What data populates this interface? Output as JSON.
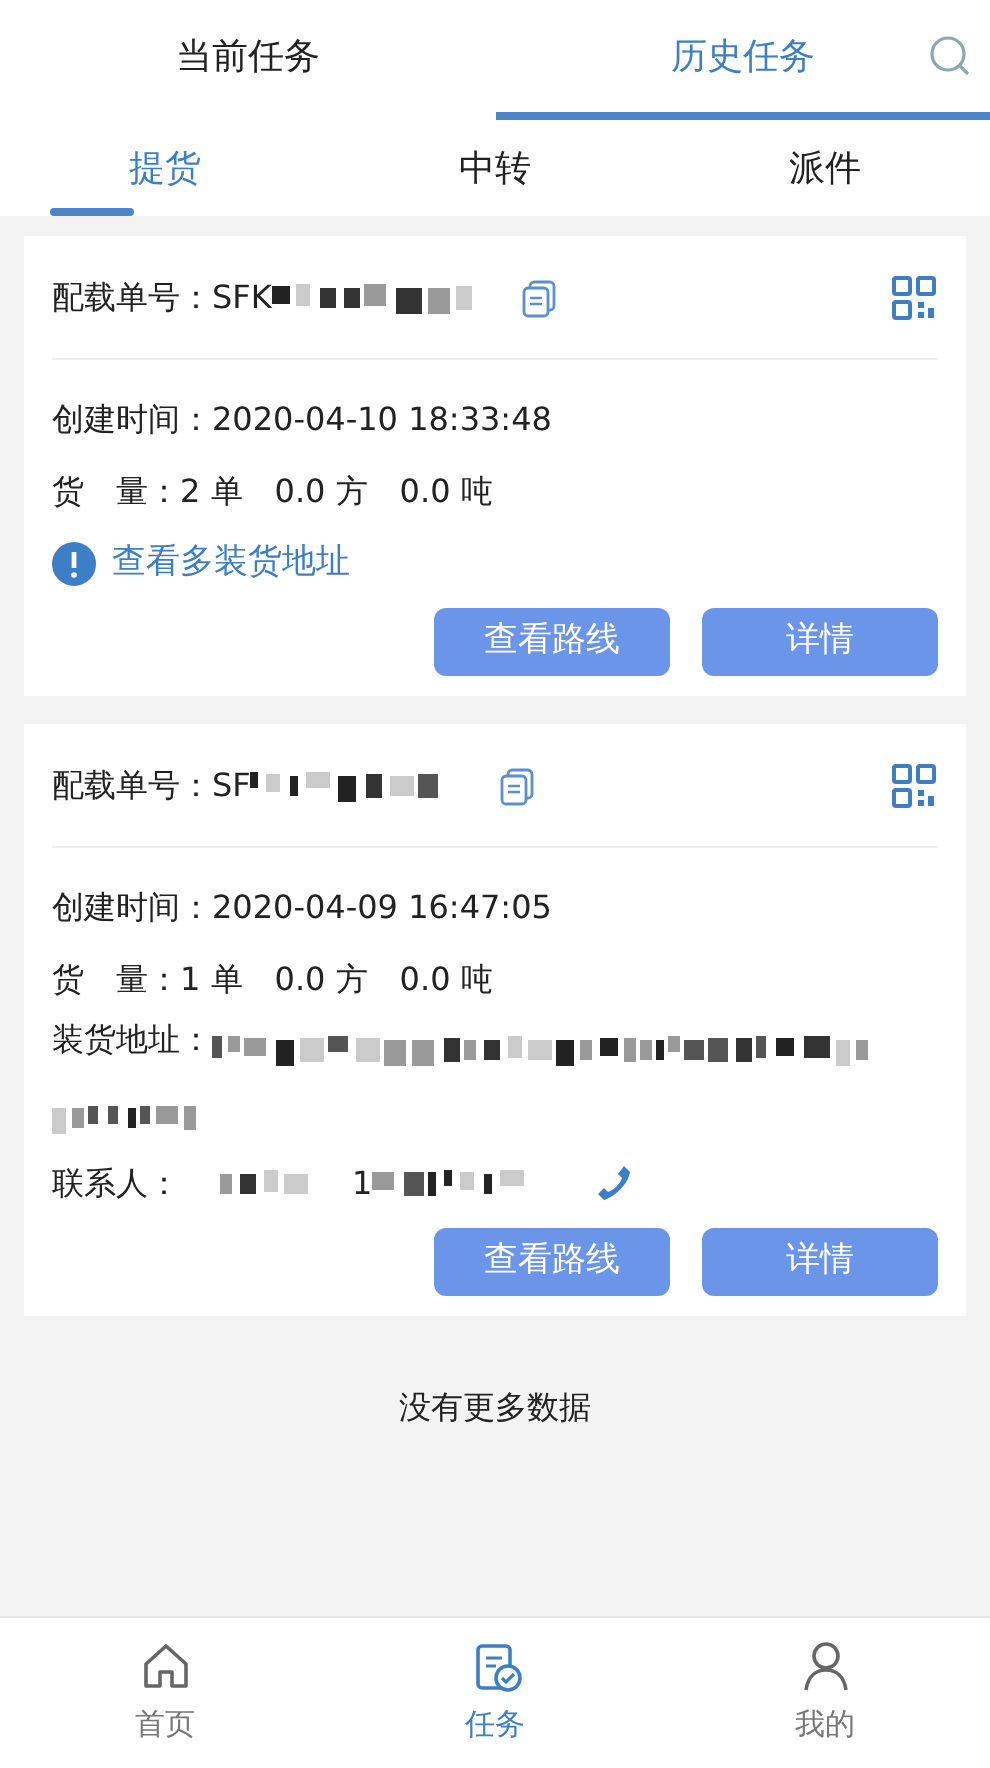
{
  "top_tabs": [
    {
      "label": "当前任务",
      "selected": false
    },
    {
      "label": "历史任务",
      "selected": true
    }
  ],
  "sub_tabs": [
    {
      "label": "提货",
      "selected": true
    },
    {
      "label": "中转",
      "selected": false
    },
    {
      "label": "派件",
      "selected": false
    }
  ],
  "cards": [
    {
      "order_label": "配载单号：",
      "order_no": "SFK",
      "rows": [
        {
          "kind": "text",
          "label": "创建时间：",
          "value": "2020-04-10 18:33:48"
        },
        {
          "kind": "text",
          "label": "货　量：",
          "value": "2 单　0.0 方　0.0 吨"
        },
        {
          "kind": "link",
          "text": "查看多装货地址"
        }
      ],
      "buttons": [
        "查看路线",
        "详情"
      ]
    },
    {
      "order_label": "配载单号：",
      "order_no": "SF",
      "rows": [
        {
          "kind": "text",
          "label": "创建时间：",
          "value": "2020-04-09 16:47:05"
        },
        {
          "kind": "text",
          "label": "货　量：",
          "value": "1 单　0.0 方　0.0 吨"
        },
        {
          "kind": "address",
          "label": "装货地址："
        },
        {
          "kind": "contact",
          "label": "联系人：",
          "phone": "1"
        }
      ],
      "buttons": [
        "查看路线",
        "详情"
      ]
    }
  ],
  "footer_note": "没有更多数据",
  "bottom_nav": [
    {
      "label": "首页",
      "kind": "home",
      "selected": false
    },
    {
      "label": "任务",
      "kind": "task",
      "selected": true
    },
    {
      "label": "我的",
      "kind": "user",
      "selected": false
    }
  ]
}
